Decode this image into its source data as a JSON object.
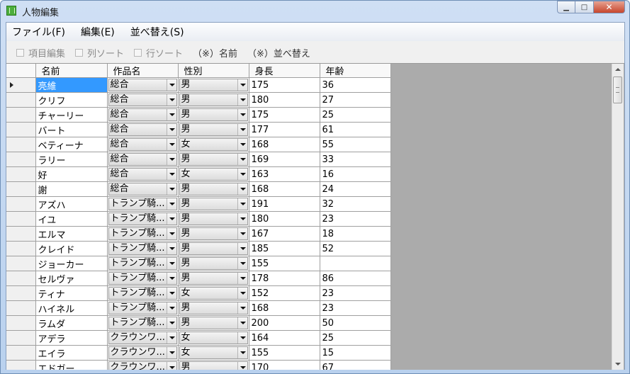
{
  "window": {
    "title": "人物編集",
    "minimize_glyph": "▁",
    "maximize_glyph": "□",
    "close_glyph": "✕"
  },
  "menu": [
    {
      "label": "ファイル(F)"
    },
    {
      "label": "編集(E)"
    },
    {
      "label": "並べ替え(S)"
    }
  ],
  "toolbar": {
    "checks": [
      {
        "label": "項目編集"
      },
      {
        "label": "列ソート"
      },
      {
        "label": "行ソート"
      }
    ],
    "notes": [
      {
        "label": "（※）名前"
      },
      {
        "label": "（※）並べ替え"
      }
    ]
  },
  "grid": {
    "columns": [
      {
        "label": "名前"
      },
      {
        "label": "作品名"
      },
      {
        "label": "性別"
      },
      {
        "label": "身長"
      },
      {
        "label": "年齢"
      }
    ],
    "current_row_index": 0,
    "selected_cell": {
      "row": 0,
      "column": "名前"
    },
    "rows": [
      {
        "name": "亮維",
        "work": "総合",
        "gender": "男",
        "height": "175",
        "age": "36"
      },
      {
        "name": "クリフ",
        "work": "総合",
        "gender": "男",
        "height": "180",
        "age": "27"
      },
      {
        "name": "チャーリー",
        "work": "総合",
        "gender": "男",
        "height": "175",
        "age": "25"
      },
      {
        "name": "バート",
        "work": "総合",
        "gender": "男",
        "height": "177",
        "age": "61"
      },
      {
        "name": "ベティーナ",
        "work": "総合",
        "gender": "女",
        "height": "168",
        "age": "55"
      },
      {
        "name": "ラリー",
        "work": "総合",
        "gender": "男",
        "height": "169",
        "age": "33"
      },
      {
        "name": "好",
        "work": "総合",
        "gender": "女",
        "height": "163",
        "age": "16"
      },
      {
        "name": "謝",
        "work": "総合",
        "gender": "男",
        "height": "168",
        "age": "24"
      },
      {
        "name": "アズハ",
        "work": "トランプ騎...",
        "gender": "男",
        "height": "191",
        "age": "32"
      },
      {
        "name": "イユ",
        "work": "トランプ騎...",
        "gender": "男",
        "height": "180",
        "age": "23"
      },
      {
        "name": "エルマ",
        "work": "トランプ騎...",
        "gender": "男",
        "height": "167",
        "age": "18"
      },
      {
        "name": "クレイド",
        "work": "トランプ騎...",
        "gender": "男",
        "height": "185",
        "age": "52"
      },
      {
        "name": "ジョーカー",
        "work": "トランプ騎...",
        "gender": "男",
        "height": "155",
        "age": ""
      },
      {
        "name": "セルヴァ",
        "work": "トランプ騎...",
        "gender": "男",
        "height": "178",
        "age": "86"
      },
      {
        "name": "ティナ",
        "work": "トランプ騎...",
        "gender": "女",
        "height": "152",
        "age": "23"
      },
      {
        "name": "ハイネル",
        "work": "トランプ騎...",
        "gender": "男",
        "height": "168",
        "age": "23"
      },
      {
        "name": "ラムダ",
        "work": "トランプ騎...",
        "gender": "男",
        "height": "200",
        "age": "50"
      },
      {
        "name": "アデラ",
        "work": "クラウンワ...",
        "gender": "女",
        "height": "164",
        "age": "25"
      },
      {
        "name": "エイラ",
        "work": "クラウンワ...",
        "gender": "女",
        "height": "155",
        "age": "15"
      },
      {
        "name": "エドガー",
        "work": "クラウンワ...",
        "gender": "男",
        "height": "170",
        "age": "67"
      }
    ]
  },
  "colors": {
    "selection": "#3399ff",
    "grid_background": "#ababab",
    "titlebar": "#b9d1ee"
  }
}
